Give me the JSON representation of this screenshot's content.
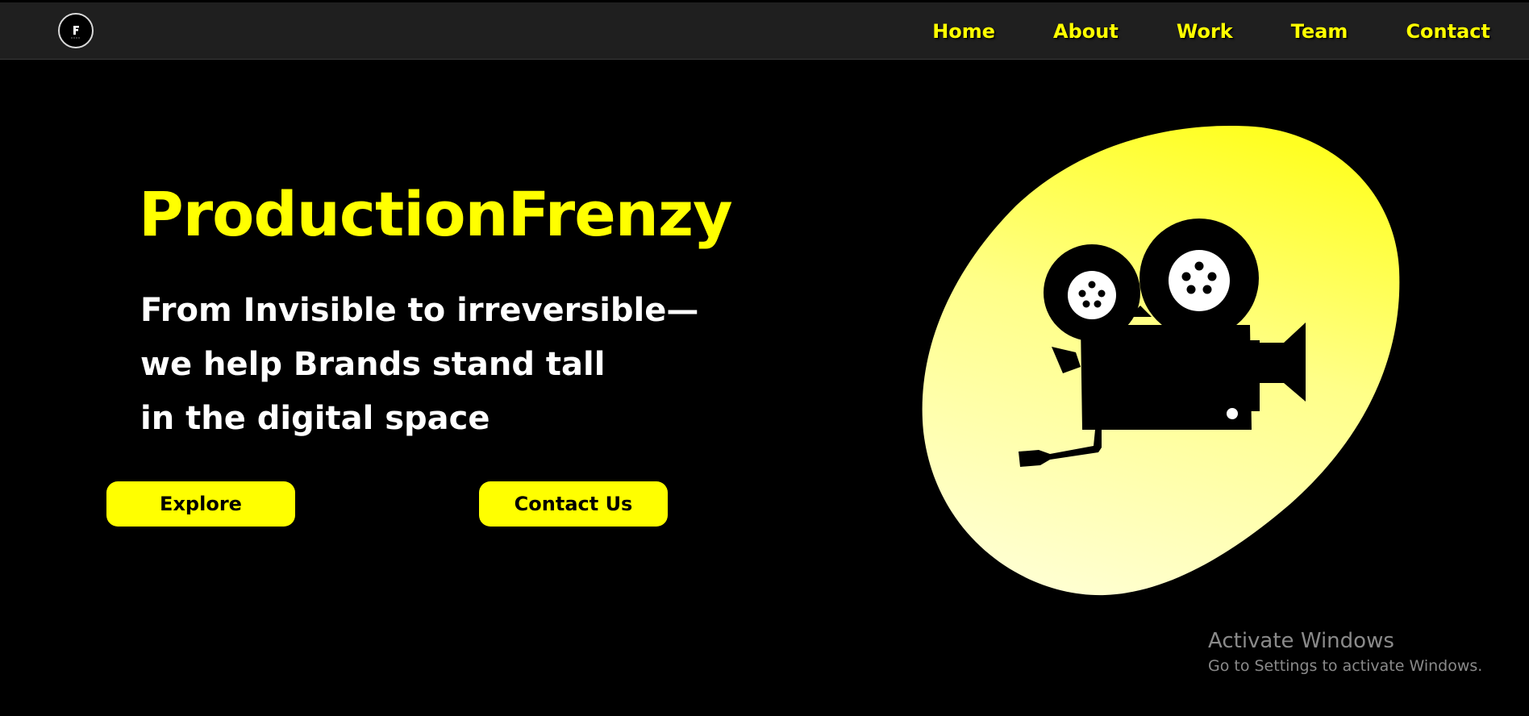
{
  "header": {
    "logo_icon": "production-frenzy-logo",
    "nav": [
      {
        "label": "Home"
      },
      {
        "label": "About"
      },
      {
        "label": "Work"
      },
      {
        "label": "Team"
      },
      {
        "label": "Contact"
      }
    ]
  },
  "hero": {
    "brand": "ProductionFrenzy",
    "tagline_lines": [
      "From Invisible to irreversible—",
      "we help Brands stand tall",
      "in the digital space"
    ],
    "buttons": {
      "explore": "Explore",
      "contact": "Contact Us"
    },
    "illustration_icon": "movie-camera-icon"
  },
  "watermark": {
    "title": "Activate Windows",
    "subtitle": "Go to Settings to activate Windows."
  },
  "colors": {
    "background": "#000000",
    "navbar": "#1f1f1f",
    "accent": "#ffff00",
    "text": "#ffffff",
    "watermark": "#8a8a8a"
  }
}
